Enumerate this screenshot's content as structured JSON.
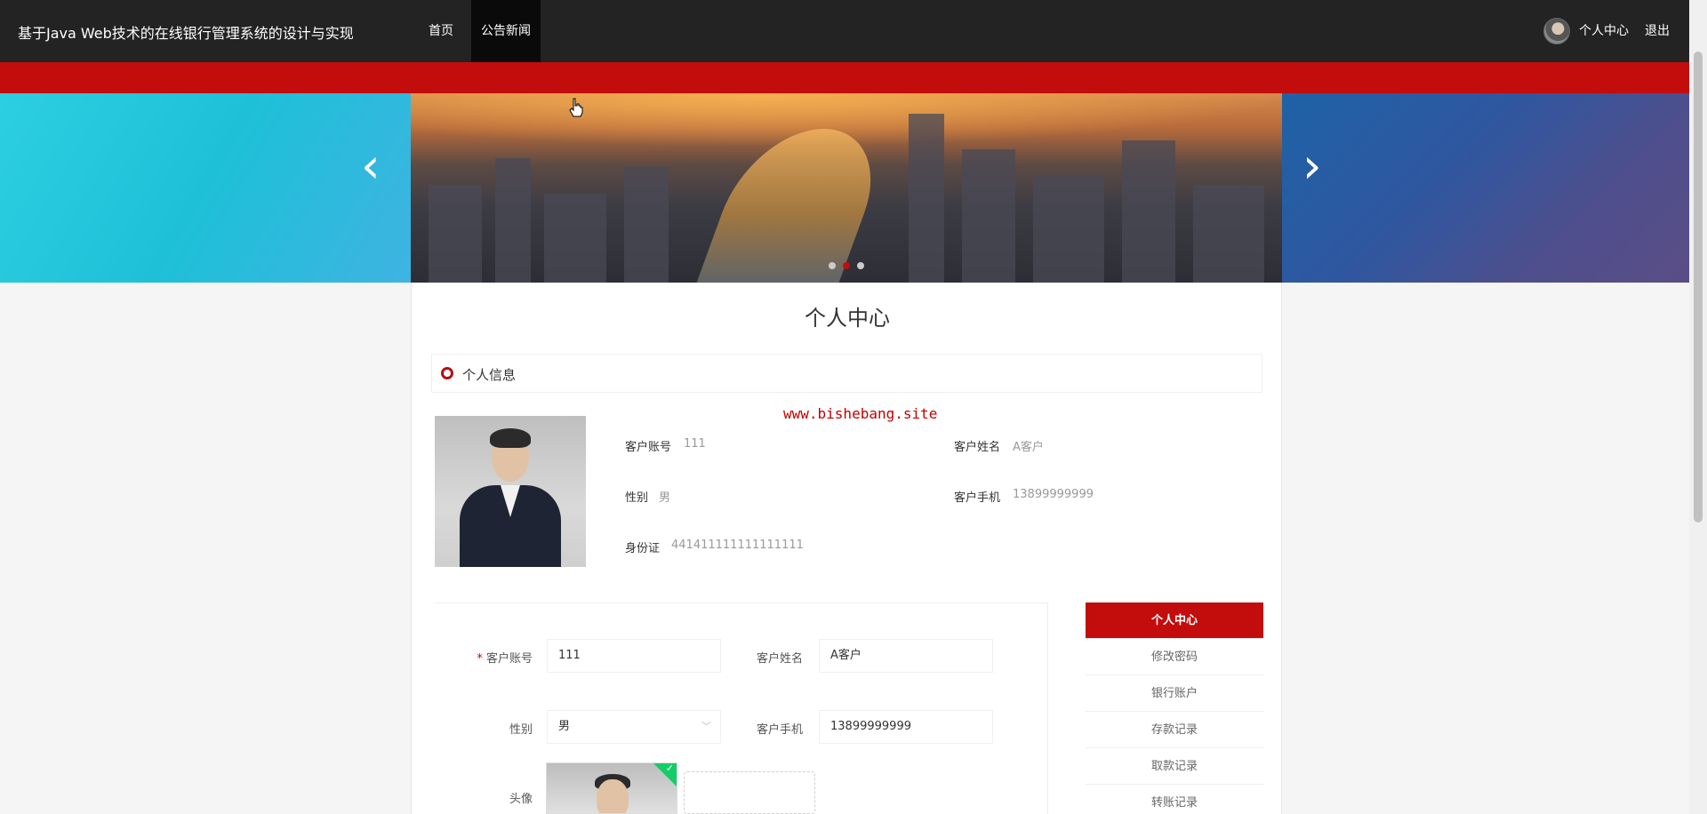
{
  "header": {
    "site_title": "基于Java Web技术的在线银行管理系统的设计与实现",
    "nav": {
      "home": "首页",
      "news": "公告新闻"
    },
    "user_center": "个人中心",
    "logout": "退出"
  },
  "banner": {
    "prev": "‹",
    "next": "›",
    "slide_count": 3,
    "active_slide": 2
  },
  "page": {
    "title": "个人中心",
    "section_title": "个人信息",
    "watermark": "www.bishebang.site"
  },
  "profile": {
    "account_label": "客户账号",
    "account_value": "111",
    "name_label": "客户姓名",
    "name_value": "A客户",
    "gender_label": "性别",
    "gender_value": "男",
    "phone_label": "客户手机",
    "phone_value": "13899999999",
    "id_label": "身份证",
    "id_value": "441411111111111111"
  },
  "form": {
    "required_mark": "*",
    "account_label": "客户账号",
    "account_value": "111",
    "name_label": "客户姓名",
    "name_value": "A客户",
    "gender_label": "性别",
    "gender_value": "男",
    "phone_label": "客户手机",
    "phone_value": "13899999999",
    "avatar_label": "头像"
  },
  "side_menu": {
    "items": [
      {
        "label": "个人中心"
      },
      {
        "label": "修改密码"
      },
      {
        "label": "银行账户"
      },
      {
        "label": "存款记录"
      },
      {
        "label": "取款记录"
      },
      {
        "label": "转账记录"
      }
    ]
  },
  "colors": {
    "brand_red": "#c30d0d",
    "nav_dark": "#232323"
  }
}
